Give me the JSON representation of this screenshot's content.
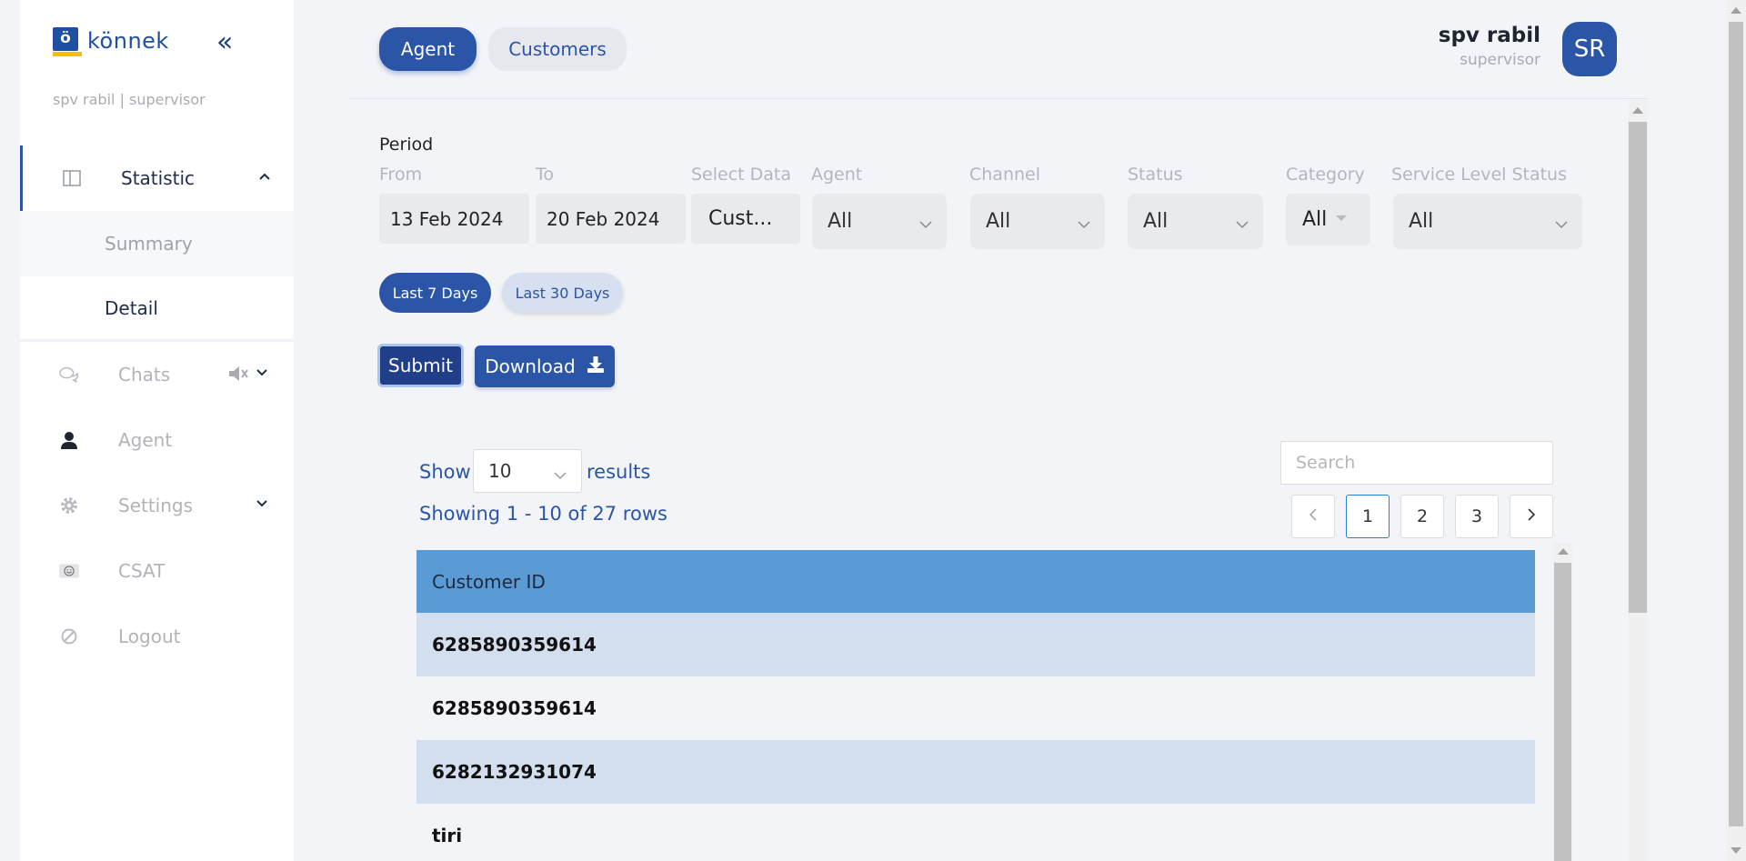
{
  "sidebar": {
    "brand": "könnek",
    "brand_letter": "ö",
    "user_line": "spv rabil | supervisor",
    "nav": {
      "statistic": "Statistic",
      "summary": "Summary",
      "detail": "Detail",
      "chats": "Chats",
      "agent": "Agent",
      "settings": "Settings",
      "csat": "CSAT",
      "logout": "Logout"
    }
  },
  "header": {
    "tabs": {
      "agent": "Agent",
      "customers": "Customers"
    },
    "user_name": "spv rabil",
    "user_role": "supervisor",
    "avatar_initials": "SR"
  },
  "filters": {
    "period_label": "Period",
    "from_label": "From",
    "from_value": "13 Feb 2024",
    "to_label": "To",
    "to_value": "20 Feb 2024",
    "select_data_label": "Select Data",
    "select_data_value": "Cust...",
    "agent_label": "Agent",
    "agent_value": "All",
    "channel_label": "Channel",
    "channel_value": "All",
    "status_label": "Status",
    "status_value": "All",
    "category_label": "Category",
    "category_value": "All",
    "service_level_label": "Service Level Status",
    "service_level_value": "All",
    "last7": "Last 7 Days",
    "last30": "Last 30 Days",
    "submit": "Submit",
    "download": "Download"
  },
  "table": {
    "show_label": "Show",
    "page_size": "10",
    "results_label": "results",
    "showing": "Showing 1 - 10 of 27 rows",
    "search_placeholder": "Search",
    "pages": [
      "1",
      "2",
      "3"
    ],
    "current_page": "1",
    "header": "Customer ID",
    "rows": [
      "6285890359614",
      "6285890359614",
      "6282132931074",
      "tiri"
    ]
  },
  "colors": {
    "primary": "#2b55a6",
    "table_header": "#5b9bd5",
    "row_alt": "#d3deef"
  }
}
